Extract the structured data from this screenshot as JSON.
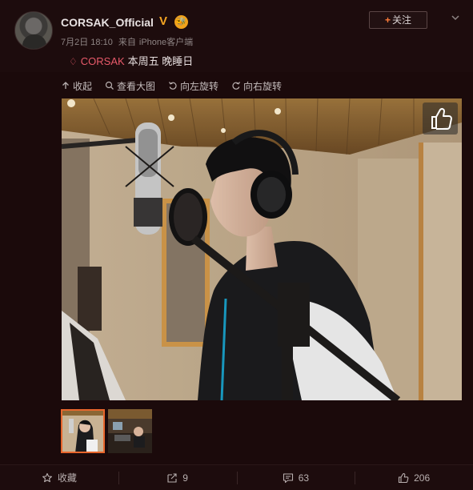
{
  "header": {
    "username": "CORSAK_Official",
    "vip_mark": "V",
    "level_mark": "🐝",
    "date": "7月2日 18:10",
    "source_prefix": "来自",
    "source": "iPhone客户端",
    "follow_label": "关注",
    "follow_plus": "+"
  },
  "post": {
    "topic": "CORSAK",
    "text": "本周五 晚睡日"
  },
  "toolbar": {
    "collapse": "收起",
    "view_large": "查看大图",
    "rotate_left": "向左旋转",
    "rotate_right": "向右旋转"
  },
  "actions": {
    "favorite": "收藏",
    "repost_count": "9",
    "comment_count": "63",
    "like_count": "206"
  },
  "colors": {
    "background": "#1a0b0c",
    "accent_orange": "#e8662c",
    "topic_red": "#e85a6a",
    "vip_gold": "#f5a623"
  },
  "icons": {
    "collapse": "arrow-up-icon",
    "view_large": "magnifier-icon",
    "rotate_left": "rotate-left-icon",
    "rotate_right": "rotate-right-icon",
    "favorite": "star-icon",
    "repost": "share-icon",
    "comment": "comment-icon",
    "like": "thumbs-up-icon"
  }
}
